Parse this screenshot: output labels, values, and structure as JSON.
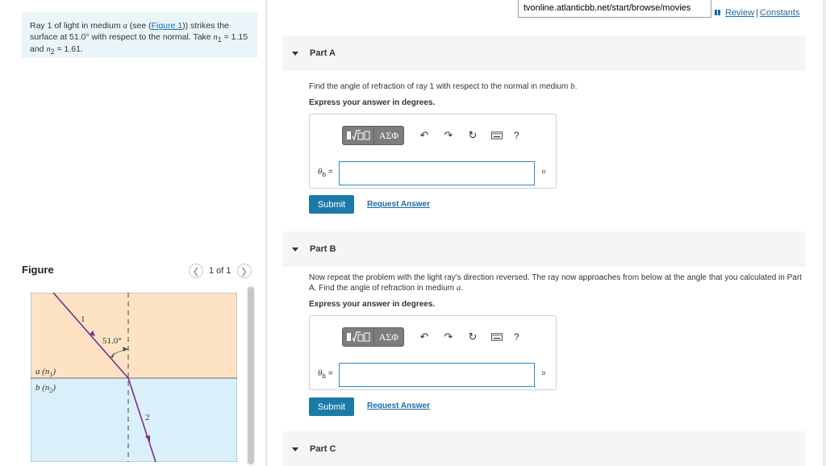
{
  "tooltip": {
    "url": "tvonline.atlanticbb.net/start/browse/movies"
  },
  "top_links": {
    "review": "Review",
    "separator": "|",
    "constants": "Constants",
    "accent": "#1a6aa8"
  },
  "problem": {
    "text_1": "Ray 1 of light in medium ",
    "medium_a": "a",
    "text_2": " (see (",
    "figure_link": "Figure 1",
    "text_3": ")) strikes the surface at 51.0° with respect to the normal. Take ",
    "n1": "n",
    "n1_sub": "1",
    "text_4": " = 1.15 and ",
    "n2": "n",
    "n2_sub": "2",
    "text_5": " = 1.61."
  },
  "figure": {
    "heading": "Figure",
    "pager": "1 of 1",
    "prev_icon": "chevron-left-icon",
    "next_icon": "chevron-right-icon",
    "ray1_label": "1",
    "ray2_label": "2",
    "angle_label": "51.0°",
    "medium_a_label": "a (n",
    "medium_a_sub": "1",
    "medium_b_label": "b (n",
    "medium_b_sub": "2",
    "close_paren": ")",
    "colors": {
      "medium_a": "#fde3c3",
      "medium_b": "#d9f0fa",
      "ray": "#7b2d8e"
    }
  },
  "parts": [
    {
      "title": "Part A",
      "question_1": "Find the angle of refraction of ray 1 with respect to the normal in medium ",
      "question_var": "b",
      "question_2": ".",
      "instruction": "Express your answer in degrees.",
      "theta": "θ",
      "theta_sub": "b",
      "equals": "=",
      "input_value": "",
      "submit": "Submit",
      "request": "Request Answer"
    },
    {
      "title": "Part B",
      "question_1": "Now repeat the problem with the light ray's direction reversed. The ray now approaches from below at the angle that you calculated in Part A. Find the angle of refraction in medium ",
      "question_var": "a",
      "question_2": ".",
      "instruction": "Express your answer in degrees.",
      "theta": "θ",
      "theta_sub": "b",
      "equals": "=",
      "input_value": "",
      "submit": "Submit",
      "request": "Request Answer"
    },
    {
      "title": "Part C"
    }
  ],
  "toolbar": {
    "templates_icon": "templates-icon",
    "greek": "ΑΣΦ",
    "undo_icon": "undo-icon",
    "redo_icon": "redo-icon",
    "reset_icon": "reset-icon",
    "keyboard_icon": "keyboard-icon",
    "help": "?"
  }
}
